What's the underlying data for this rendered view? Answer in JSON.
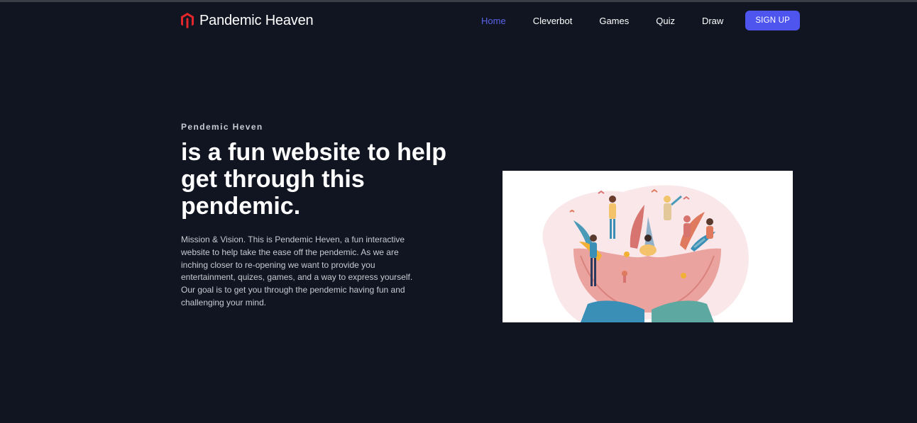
{
  "header": {
    "brand_name": "Pandemic Heaven",
    "brand_icon": "magento-logo-icon",
    "nav": [
      {
        "label": "Home",
        "active": true
      },
      {
        "label": "Cleverbot",
        "active": false
      },
      {
        "label": "Games",
        "active": false
      },
      {
        "label": "Quiz",
        "active": false
      },
      {
        "label": "Draw",
        "active": false
      }
    ],
    "signup_label": "SIGN UP"
  },
  "hero": {
    "eyebrow": "Pendemic Heven",
    "headline": "is a fun website to help get through this pendemic.",
    "description": "Mission & Vision. This is Pendemic Heven, a fun interactive website to help take the ease off the pendemic. As we are inching closer to re-opening we want to provide you entertainment, quizes, games, and a way to express yourself. Our goal is to get you through the pendemic having fun and challenging your mind."
  },
  "colors": {
    "background": "#111521",
    "accent": "#4e55ee",
    "active_nav": "#5a63e8",
    "brand_icon": "#e2262b"
  }
}
